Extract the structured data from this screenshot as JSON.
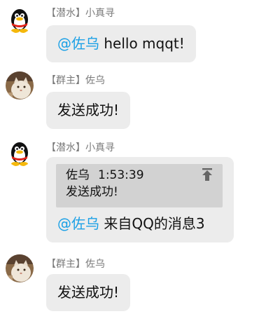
{
  "messages": [
    {
      "author_role": "【潜水】",
      "author_name": "小真寻",
      "avatar": "qq-penguin-icon",
      "mention": "@佐乌",
      "text": " hello mqqt!"
    },
    {
      "author_role": "【群主】",
      "author_name": "佐乌",
      "avatar": "cat-photo",
      "text": "发送成功!"
    },
    {
      "author_role": "【潜水】",
      "author_name": "小真寻",
      "avatar": "qq-penguin-icon",
      "quote": {
        "author": "佐乌",
        "time": "1:53:39",
        "text": "发送成功!",
        "icon": "jump-to-top-icon"
      },
      "mention": "@佐乌",
      "text": " 来自QQ的消息3"
    },
    {
      "author_role": "【群主】",
      "author_name": "佐乌",
      "avatar": "cat-photo",
      "text": "发送成功!"
    }
  ],
  "colors": {
    "bubble": "#ececec",
    "quote": "#d2d2d2",
    "mention": "#1aa0e6",
    "meta_text": "#7a7a7a"
  }
}
